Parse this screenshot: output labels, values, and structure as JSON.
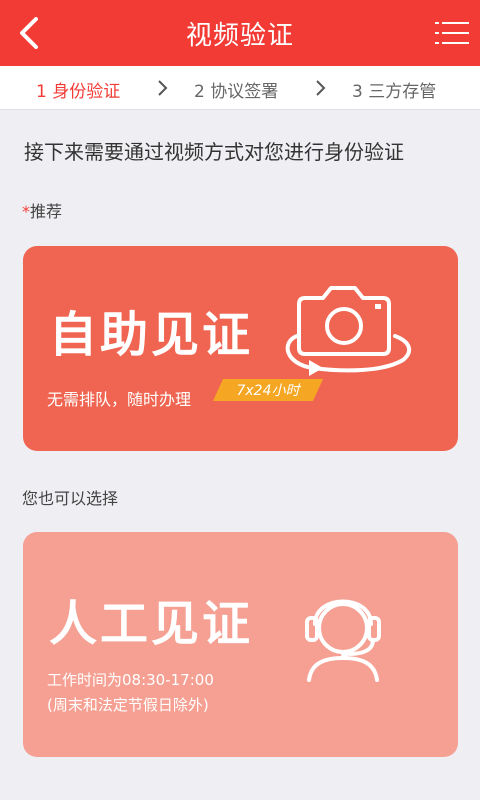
{
  "header": {
    "title": "视频验证",
    "back_icon": "back-arrow-icon",
    "menu_icon": "menu-list-icon"
  },
  "steps": [
    {
      "label": "1 身份验证",
      "active": true
    },
    {
      "label": "2 协议签署",
      "active": false
    },
    {
      "label": "3 三方存管",
      "active": false
    }
  ],
  "intro_text": "接下来需要通过视频方式对您进行身份验证",
  "recommend_label": "推荐",
  "recommend_star": "*",
  "self_witness": {
    "title": "自助见证",
    "subtitle": "无需排队，随时办理",
    "badge": "7x24小时",
    "icon": "camera-rotate-icon"
  },
  "alternative_label": "您也可以选择",
  "manual_witness": {
    "title": "人工见证",
    "work_time": "工作时间为08:30-17:00",
    "holiday_note": "(周末和法定节假日除外)",
    "icon": "headset-agent-icon"
  },
  "colors": {
    "brand_red": "#f23b35",
    "card_primary": "#ef6551",
    "card_secondary": "#f5a093",
    "badge": "#f5a623"
  }
}
